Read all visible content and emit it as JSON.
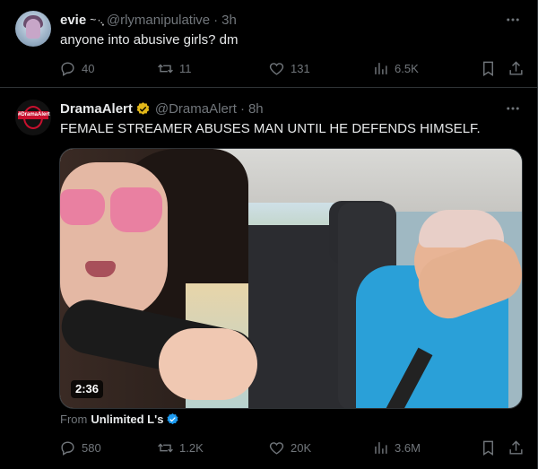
{
  "tweets": [
    {
      "display_name": "evie",
      "name_decoration": "~ ·.̩͙",
      "handle": "@rlymanipulative",
      "time": "3h",
      "text": "anyone into abusive girls? dm",
      "stats": {
        "replies": "40",
        "reposts": "11",
        "likes": "131",
        "views": "6.5K"
      }
    },
    {
      "display_name": "DramaAlert",
      "verified": true,
      "handle": "@DramaAlert",
      "time": "8h",
      "text": "FEMALE STREAMER ABUSES MAN UNTIL HE DEFENDS HIMSELF.",
      "avatar_text": "#DramaAlert",
      "media": {
        "duration": "2:36"
      },
      "from_label": "From",
      "from_source": "Unlimited L's",
      "stats": {
        "replies": "580",
        "reposts": "1.2K",
        "likes": "20K",
        "views": "3.6M"
      }
    }
  ],
  "colors": {
    "background": "#000000",
    "text": "#e7e9ea",
    "muted": "#71767b",
    "verified_gold": "#e2b719",
    "verified_blue": "#1d9bf0",
    "border": "#2f3336"
  },
  "icons": [
    "reply-icon",
    "repost-icon",
    "like-icon",
    "views-icon",
    "bookmark-icon",
    "share-icon",
    "more-icon",
    "verified-gold-badge-icon",
    "verified-blue-badge-icon"
  ]
}
